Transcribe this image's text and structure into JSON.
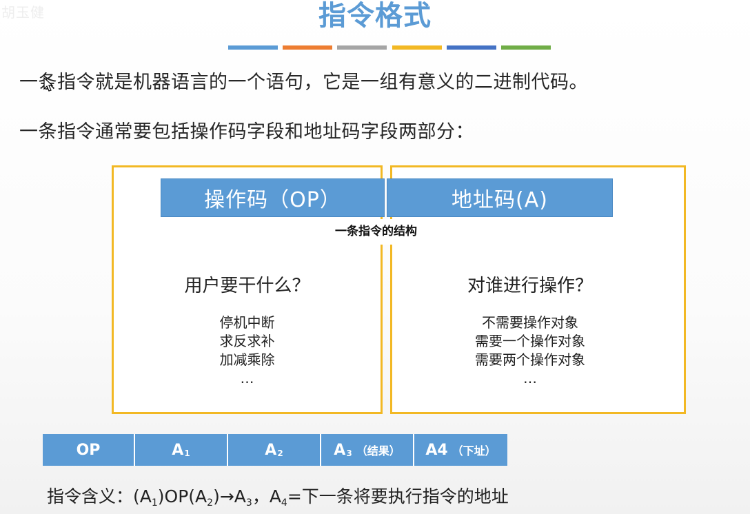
{
  "watermark": "胡玉健",
  "title": "指令格式",
  "color_bars": [
    "#5b9bd5",
    "#ed7d31",
    "#a5a5a5",
    "#f2b824",
    "#4472c4",
    "#70ad47"
  ],
  "intro": {
    "line1": "一条指令就是机器语言的一个语句，它是一组有意义的二进制代码。",
    "line2": "一条指令通常要包括操作码字段和地址码字段两部分："
  },
  "structure": {
    "opcode_header": "操作码（OP）",
    "address_header": "地址码(A)",
    "caption": "一条指令的结构",
    "left": {
      "question": "用户要干什么？",
      "items": [
        "停机中断",
        "求反求补",
        "加减乘除",
        "…"
      ]
    },
    "right": {
      "question": "对谁进行操作？",
      "items": [
        "不需要操作对象",
        "需要一个操作对象",
        "需要两个操作对象",
        "…"
      ]
    }
  },
  "format": {
    "op": "OP",
    "a1": {
      "base": "A",
      "sub": "1"
    },
    "a2": {
      "base": "A",
      "sub": "2"
    },
    "a3": {
      "base": "A",
      "sub": "3",
      "note": "（结果）"
    },
    "a4": {
      "base": "A4",
      "note": "（下址）"
    }
  },
  "meaning": {
    "prefix": "指令含义：(A",
    "s1": "1",
    "mid1": ")OP(A",
    "s2": "2",
    "mid2": ")→A",
    "s3": "3",
    "mid3": "，A",
    "s4": "4",
    "suffix": "=下一条将要执行指令的地址"
  },
  "colors": {
    "title": "#5b9bd5",
    "header_fill": "#5b9bd5",
    "panel_border": "#f2b824"
  }
}
